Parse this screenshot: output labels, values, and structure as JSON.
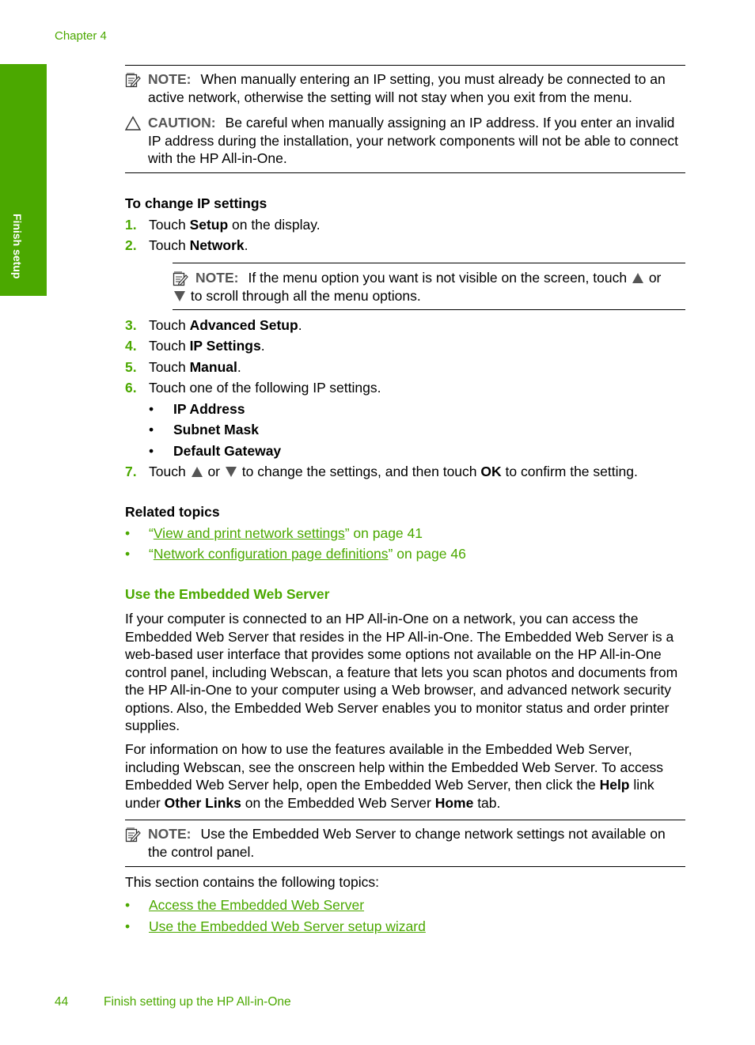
{
  "header": {
    "chapter": "Chapter 4"
  },
  "side_tab": {
    "label": "Finish setup"
  },
  "top_notes": {
    "note": {
      "label": "NOTE:",
      "text": "When manually entering an IP setting, you must already be connected to an active network, otherwise the setting will not stay when you exit from the menu."
    },
    "caution": {
      "label": "CAUTION:",
      "text": "Be careful when manually assigning an IP address. If you enter an invalid IP address during the installation, your network components will not be able to connect with the HP All-in-One."
    }
  },
  "procedure": {
    "title": "To change IP settings",
    "steps": [
      {
        "num": "1.",
        "pre": "Touch ",
        "bold": "Setup",
        "post": " on the display."
      },
      {
        "num": "2.",
        "pre": "Touch ",
        "bold": "Network",
        "post": "."
      },
      {
        "num": "3.",
        "pre": "Touch ",
        "bold": "Advanced Setup",
        "post": "."
      },
      {
        "num": "4.",
        "pre": "Touch ",
        "bold": "IP Settings",
        "post": "."
      },
      {
        "num": "5.",
        "pre": "Touch ",
        "bold": "Manual",
        "post": "."
      },
      {
        "num": "6.",
        "pre": "Touch one of the following IP settings.",
        "bold": "",
        "post": ""
      }
    ],
    "step2_note": {
      "label": "NOTE:",
      "text_a": "If the menu option you want is not visible on the screen, touch",
      "text_b": "or",
      "text_c": "to scroll through all the menu options."
    },
    "ip_options": [
      "IP Address",
      "Subnet Mask",
      "Default Gateway"
    ],
    "step7": {
      "num": "7.",
      "a": "Touch",
      "b": "or",
      "c": "to change the settings, and then touch",
      "bold": "OK",
      "d": "to confirm the setting."
    }
  },
  "related": {
    "title": "Related topics",
    "items": [
      {
        "open": "“",
        "link": "View and print network settings",
        "close": "” on page 41"
      },
      {
        "open": "“",
        "link": "Network configuration page definitions",
        "close": "” on page 46"
      }
    ]
  },
  "ews": {
    "title": "Use the Embedded Web Server",
    "para1": "If your computer is connected to an HP All-in-One on a network, you can access the Embedded Web Server that resides in the HP All-in-One. The Embedded Web Server is a web-based user interface that provides some options not available on the HP All-in-One control panel, including Webscan, a feature that lets you scan photos and documents from the HP All-in-One to your computer using a Web browser, and advanced network security options. Also, the Embedded Web Server enables you to monitor status and order printer supplies.",
    "para2": {
      "a": "For information on how to use the features available in the Embedded Web Server, including Webscan, see the onscreen help within the Embedded Web Server. To access Embedded Web Server help, open the Embedded Web Server, then click the ",
      "b1": "Help",
      "c": " link under ",
      "b2": "Other Links",
      "d": " on the Embedded Web Server ",
      "b3": "Home",
      "e": " tab."
    },
    "note": {
      "label": "NOTE:",
      "text": "Use the Embedded Web Server to change network settings not available on the control panel."
    },
    "topics_intro": "This section contains the following topics:",
    "topics": [
      "Access the Embedded Web Server",
      "Use the Embedded Web Server setup wizard"
    ]
  },
  "footer": {
    "page": "44",
    "title": "Finish setting up the HP All-in-One"
  }
}
